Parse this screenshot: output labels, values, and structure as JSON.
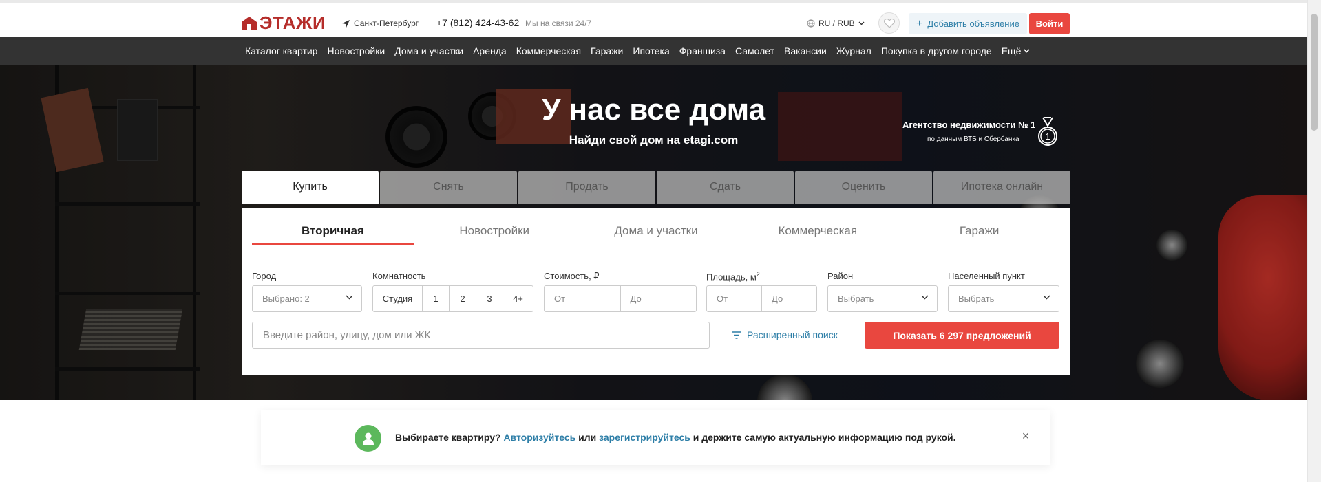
{
  "header": {
    "logo_text": "ЭТАЖИ",
    "city": "Санкт-Петербург",
    "phone": "+7 (812) 424-43-62",
    "support": "Мы на связи 24/7",
    "lang_currency": "RU / RUB",
    "add_ad_label": "Добавить объявление",
    "login_label": "Войти"
  },
  "nav": {
    "items": [
      "Каталог квартир",
      "Новостройки",
      "Дома и участки",
      "Аренда",
      "Коммерческая",
      "Гаражи",
      "Ипотека",
      "Франшиза",
      "Самолет",
      "Вакансии",
      "Журнал",
      "Покупка в другом городе"
    ],
    "more_label": "Ещё"
  },
  "hero": {
    "title": "У нас все дома",
    "subtitle": "Найди свой дом на etagi.com",
    "award_title": "Агентство недвижимости № 1",
    "award_link": "по данным ВТБ и Сбербанка",
    "medal_number": "1"
  },
  "modes": [
    "Купить",
    "Снять",
    "Продать",
    "Сдать",
    "Оценить",
    "Ипотека онлайн"
  ],
  "search": {
    "categories": [
      "Вторичная",
      "Новостройки",
      "Дома и участки",
      "Коммерческая",
      "Гаражи"
    ],
    "city_label": "Город",
    "city_value": "Выбрано: 2",
    "rooms_label": "Комнатность",
    "rooms": [
      "Студия",
      "1",
      "2",
      "3",
      "4+"
    ],
    "price_label": "Стоимость, ₽",
    "price_from": "От",
    "price_to": "До",
    "area_label": "Площадь, м",
    "area_sup": "2",
    "area_from": "От",
    "area_to": "До",
    "district_label": "Район",
    "district_value": "Выбрать",
    "locality_label": "Населенный пункт",
    "locality_value": "Выбрать",
    "address_placeholder": "Введите район, улицу, дом или ЖК",
    "advanced_label": "Расширенный поиск",
    "show_button": "Показать 6 297 предложений"
  },
  "notice": {
    "text1": "Выбираете квартиру?",
    "link1": "Авторизуйтесь",
    "text2": "или",
    "link2": "зарегистрируйтесь",
    "text3": "и держите самую актуальную информацию под рукой.",
    "close": "×"
  },
  "colors": {
    "brand_red": "#b52d2a",
    "accent_red": "#e9473f",
    "link_blue": "#2d7ea7",
    "nav_bg": "#333333",
    "success_green": "#5cb85c"
  }
}
